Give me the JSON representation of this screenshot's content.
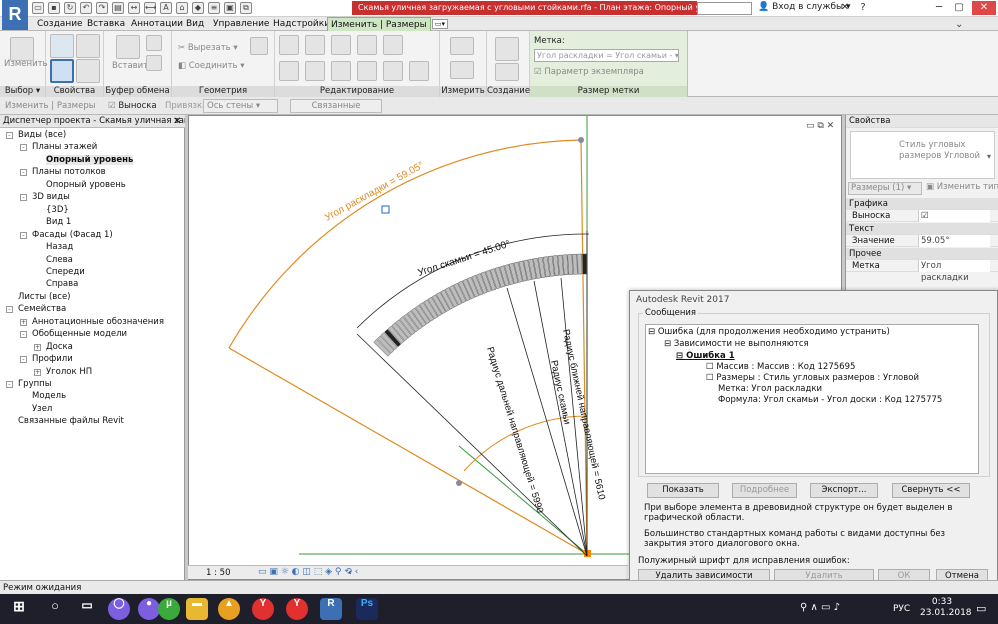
{
  "app": {
    "logo": "R",
    "doc_title": "Скамья уличная загружаемая с угловыми стойками.rfa - План этажа: Опорный уровень",
    "login": "Вход в службы"
  },
  "colors": {
    "accent_context_tab": "#cfe6c5",
    "title_highlight": "#c83030",
    "dim_orange": "#e08a20",
    "bench_gray": "#888888"
  },
  "tabs": [
    "Создание",
    "Вставка",
    "Аннотации",
    "Вид",
    "Управление",
    "Надстройки",
    "Изменить | Размеры"
  ],
  "ribbon": {
    "groups": [
      "Выбор",
      "Свойства",
      "Буфер обмена",
      "Геометрия",
      "Редактирование",
      "Измерить",
      "Создание",
      "Размер метки"
    ],
    "modify_label": "Изменить",
    "paste_label": "Вставить",
    "cut_label": "Вырезать",
    "join_label": "Соединить",
    "metka": {
      "label": "Метка:",
      "value": "Угол раскладки = Угол скамьи -",
      "instance_param": "Параметр экземпляра"
    }
  },
  "optionsbar": {
    "context": "Изменить | Размеры",
    "leader": "Выноска",
    "snap": "Привязка",
    "snap_value": "Ось стены",
    "linked": "Связанные размеры"
  },
  "project_browser": {
    "title": "Диспетчер проекта - Скамья уличная загру...",
    "items": [
      {
        "label": "Виды (все)",
        "level": 0,
        "pm": "-"
      },
      {
        "label": "Планы этажей",
        "level": 1,
        "pm": "-"
      },
      {
        "label": "Опорный уровень",
        "level": 2,
        "bold": true
      },
      {
        "label": "Планы потолков",
        "level": 1,
        "pm": "-"
      },
      {
        "label": "Опорный уровень",
        "level": 2
      },
      {
        "label": "3D виды",
        "level": 1,
        "pm": "-"
      },
      {
        "label": "{3D}",
        "level": 2
      },
      {
        "label": "Вид 1",
        "level": 2
      },
      {
        "label": "Фасады (Фасад 1)",
        "level": 1,
        "pm": "-"
      },
      {
        "label": "Назад",
        "level": 2
      },
      {
        "label": "Слева",
        "level": 2
      },
      {
        "label": "Спереди",
        "level": 2
      },
      {
        "label": "Справа",
        "level": 2
      },
      {
        "label": "Листы (все)",
        "level": 0
      },
      {
        "label": "Семейства",
        "level": 0,
        "pm": "-"
      },
      {
        "label": "Аннотационные обозначения",
        "level": 1,
        "pm": "+"
      },
      {
        "label": "Обобщенные модели",
        "level": 1,
        "pm": "-"
      },
      {
        "label": "Доска",
        "level": 2,
        "pm": "+"
      },
      {
        "label": "Профили",
        "level": 1,
        "pm": "-"
      },
      {
        "label": "Уголок НП",
        "level": 2,
        "pm": "+"
      },
      {
        "label": "Группы",
        "level": 0,
        "pm": "-"
      },
      {
        "label": "Модель",
        "level": 1
      },
      {
        "label": "Узел",
        "level": 1
      },
      {
        "label": "Связанные файлы Revit",
        "level": 0
      }
    ]
  },
  "drawing": {
    "dim_layout_angle": "Угол раскладки = 59.05°",
    "dim_bench_angle": "Угол скамьи = 45.00°",
    "dim_radius_far": "Радиус дальней направляющей = 5990",
    "dim_radius_near": "Радиус ближней направляющей = 5610",
    "dim_radius_bench": "Радиус скамьи",
    "scale": "1 : 50"
  },
  "properties": {
    "title": "Свойства",
    "type_name": "Стиль угловых размеров Угловой",
    "selector": "Размеры (1)",
    "edit_type": "Изменить тип",
    "sections": [
      {
        "category": "Графика",
        "rows": [
          {
            "key": "Выноска",
            "value": "☑"
          }
        ]
      },
      {
        "category": "Текст",
        "rows": [
          {
            "key": "Значение",
            "value": "59.05°"
          }
        ]
      },
      {
        "category": "Прочее",
        "rows": [
          {
            "key": "Метка",
            "value": "Угол раскладки"
          }
        ]
      }
    ]
  },
  "dialog": {
    "title": "Autodesk Revit 2017",
    "messages_label": "Сообщения",
    "tree": [
      "Ошибка (для продолжения необходимо устранить)",
      "Зависимости не выполняются",
      "Ошибка 1",
      "Массив : Массив : Код 1275695",
      "Размеры : Стиль угловых размеров : Угловой",
      "Метка: Угол раскладки",
      "Формула: Угол скамьи - Угол доски : Код 1275775"
    ],
    "buttons": {
      "show": "Показать",
      "more": "Подробнее",
      "export": "Экспорт...",
      "collapse": "Свернуть <<"
    },
    "hint1": "При выборе элемента в древовидной структуре он будет выделен в графической области.",
    "hint2": "Большинство стандартных команд работы с видами доступны без закрытия этого диалогового окна.",
    "fix_label": "Полужирный шрифт для исправления ошибок:",
    "footer_buttons": {
      "delete_dep": "Удалить зависимости",
      "delete_marked": "Удалить отмеченные...",
      "ok": "ОК",
      "cancel": "Отмена"
    }
  },
  "status": "Режим ожидания",
  "taskbar": {
    "lang": "РУС",
    "time": "0:33",
    "date": "23.01.2018"
  }
}
